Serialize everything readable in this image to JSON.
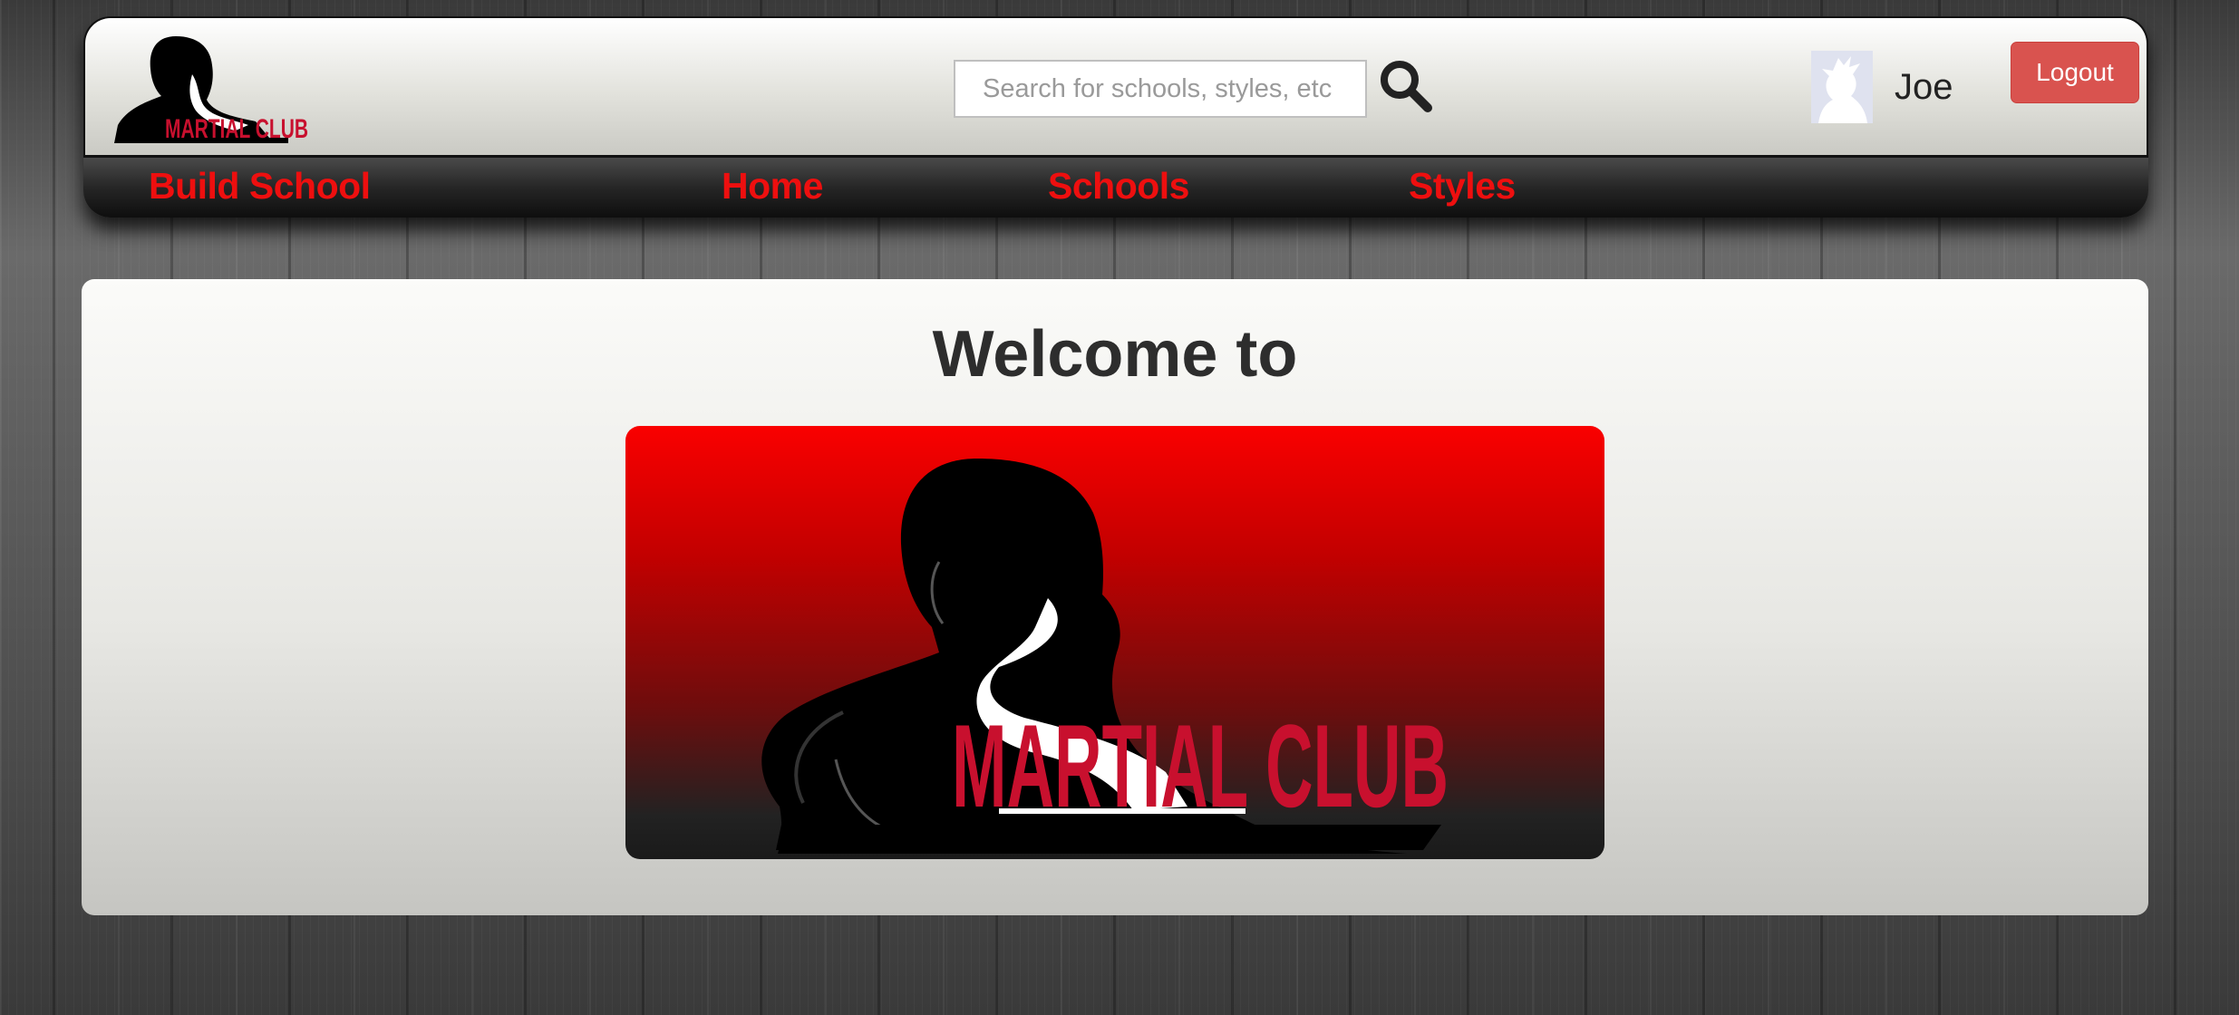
{
  "brand": {
    "logo_text": "MARTIAL CLUB",
    "primary_color": "#ee0f0f",
    "logo_red": "#c8102e"
  },
  "search": {
    "placeholder": "Search for schools, styles, etc",
    "value": "",
    "icon": "search-icon"
  },
  "user": {
    "name": "Joe",
    "avatar_icon": "avatar-silhouette",
    "logout_label": "Logout",
    "logout_color": "#d9534f"
  },
  "nav": {
    "items": [
      {
        "label": "Build School"
      },
      {
        "label": "Home"
      },
      {
        "label": "Schools"
      },
      {
        "label": "Styles"
      }
    ]
  },
  "main": {
    "welcome_text": "Welcome to"
  }
}
